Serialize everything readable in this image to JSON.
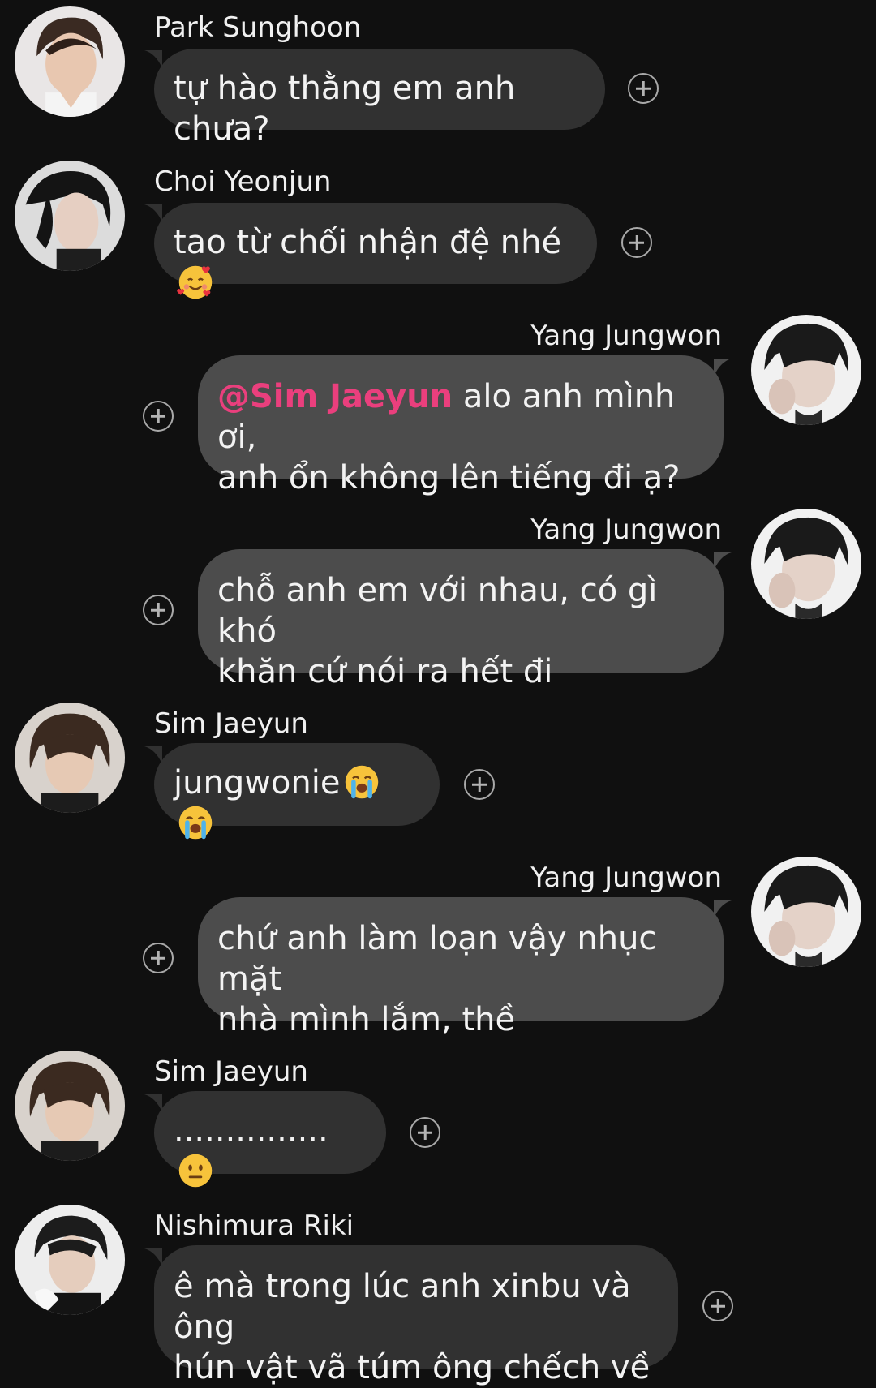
{
  "messages": [
    {
      "sender": "Park Sunghoon",
      "direction": "in",
      "text": "tự hào thằng em anh chưa?"
    },
    {
      "sender": "Choi Yeonjun",
      "direction": "in",
      "text": "tao từ chối nhận đệ nhé",
      "emoji": "smiling-face-with-hearts"
    },
    {
      "sender": "Yang Jungwon",
      "direction": "out",
      "mention": "@Sim Jaeyun",
      "text_line1": " alo anh mình ơi,",
      "text_line2": "anh ổn không lên tiếng đi ạ?"
    },
    {
      "sender": "Yang Jungwon",
      "direction": "out",
      "text_line1": "chỗ anh em với nhau, có gì khó",
      "text_line2": "khăn cứ nói ra hết đi"
    },
    {
      "sender": "Sim Jaeyun",
      "direction": "in",
      "text": "jungwonie",
      "emoji": "loudly-crying-face x2"
    },
    {
      "sender": "Yang Jungwon",
      "direction": "out",
      "text_line1": "chứ anh làm loạn vậy nhục mặt",
      "text_line2": "nhà mình lắm, thề"
    },
    {
      "sender": "Sim Jaeyun",
      "direction": "in",
      "text": "...............",
      "emoji": "neutral-face"
    },
    {
      "sender": "Nishimura Riki",
      "direction": "in",
      "text_line1": "ê mà trong lúc anh xinbu và ông",
      "text_line2": "hún vật vã túm ông chếch về"
    }
  ],
  "colors": {
    "background": "#101010",
    "incoming_bubble": "#313131",
    "outgoing_bubble": "#4c4c4c",
    "mention": "#ea3f7d"
  },
  "icons": {
    "react": "add-reaction-icon"
  }
}
